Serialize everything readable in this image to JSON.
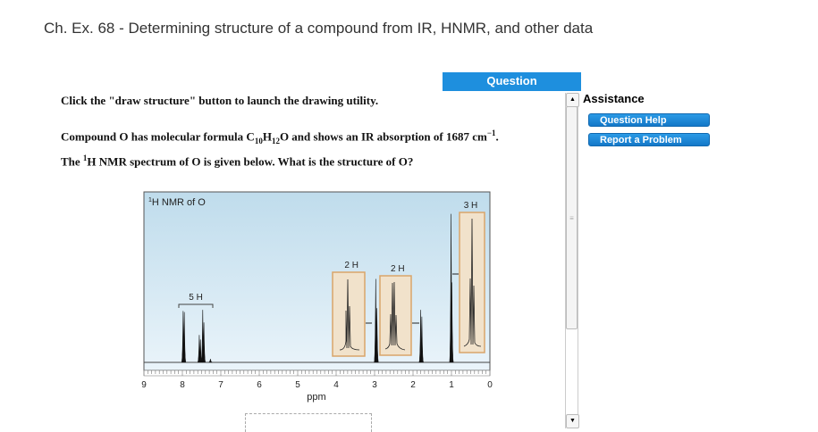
{
  "title": "Ch. Ex. 68 - Determining structure of a compound from IR, HNMR, and other data",
  "question_tab": "Question",
  "instructions": "Click the \"draw structure\" button to launch the drawing utility.",
  "compound": {
    "pre": "Compound O has molecular formula C",
    "s1": "10",
    "h": "H",
    "s2": "12",
    "post": "O and shows an IR absorption of 1687 cm",
    "sup": "−1",
    "end": "."
  },
  "spectrum_line": {
    "pre": "The ",
    "sup": "1",
    "post": "H NMR spectrum of O is given below. What is the structure of O?"
  },
  "assistance": {
    "title": "Assistance",
    "buttons": [
      "Question Help",
      "Report a Problem"
    ]
  },
  "chart_data": {
    "type": "line",
    "title_sup": "1",
    "title": "H NMR of O",
    "xlabel": "ppm",
    "xlim": [
      9,
      0
    ],
    "ticks": [
      "9",
      "8",
      "7",
      "6",
      "5",
      "4",
      "3",
      "2",
      "1",
      "0"
    ],
    "peaks": [
      {
        "ppm": 7.98,
        "height": 0.9
      },
      {
        "ppm": 7.95,
        "height": 0.88
      },
      {
        "ppm": 7.56,
        "height": 0.48
      },
      {
        "ppm": 7.53,
        "height": 0.4
      },
      {
        "ppm": 7.47,
        "height": 0.92
      },
      {
        "ppm": 7.44,
        "height": 0.7
      },
      {
        "ppm": 7.27,
        "height": 0.06
      },
      {
        "ppm": 2.97,
        "height": 1.46
      },
      {
        "ppm": 2.94,
        "height": 0.95
      },
      {
        "ppm": 1.8,
        "height": 0.92
      },
      {
        "ppm": 1.77,
        "height": 0.8
      },
      {
        "ppm": 1.01,
        "height": 2.6
      },
      {
        "ppm": 0.99,
        "height": 1.4
      }
    ],
    "integrations": [
      {
        "label": "5 H",
        "ppm": 7.65
      },
      {
        "label": "2 H",
        "ppm": 3.6
      },
      {
        "label": "2 H",
        "ppm": 2.4
      },
      {
        "label": "3 H",
        "ppm": 0.5
      }
    ]
  },
  "colors": {
    "accent": "#1e8fde",
    "plot_top": "#bfdcec",
    "plot_bottom": "#e8f3fa",
    "inset": "#f1e2cb",
    "inset_border": "#d9a56a"
  }
}
